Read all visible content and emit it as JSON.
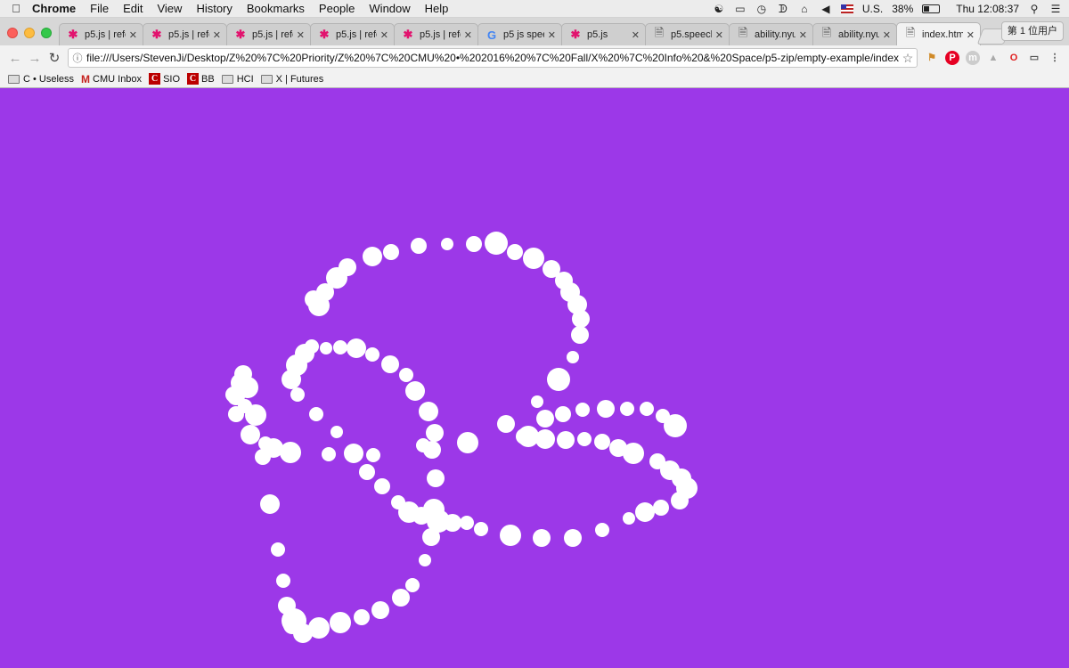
{
  "menubar": {
    "app": "Chrome",
    "items": [
      "File",
      "Edit",
      "View",
      "History",
      "Bookmarks",
      "People",
      "Window",
      "Help"
    ],
    "input_source": "U.S.",
    "battery": "38%",
    "battery_level": 0.38,
    "clock": "Thu 12:08:37"
  },
  "tabs": [
    {
      "title": "p5.js | refe",
      "icon": "p5-star-icon"
    },
    {
      "title": "p5.js | refe",
      "icon": "p5-star-icon"
    },
    {
      "title": "p5.js | refe",
      "icon": "p5-star-icon"
    },
    {
      "title": "p5.js | refe",
      "icon": "p5-star-icon"
    },
    {
      "title": "p5.js | refe",
      "icon": "p5-star-icon"
    },
    {
      "title": "p5 js spee",
      "icon": "google-icon"
    },
    {
      "title": "p5.js",
      "icon": "p5-star-icon"
    },
    {
      "title": "p5.speech",
      "icon": "document-icon"
    },
    {
      "title": "ability.nyu",
      "icon": "document-icon"
    },
    {
      "title": "ability.nyu",
      "icon": "document-icon"
    },
    {
      "title": "index.html",
      "icon": "document-icon",
      "active": true
    }
  ],
  "profile_label": "第 1 位用户",
  "address": {
    "url": "file:///Users/StevenJi/Desktop/Z%20%7C%20Priority/Z%20%7C%20CMU%20•%202016%20%7C%20Fall/X%20%7C%20Info%20&%20Space/p5-zip/empty-example/index.html"
  },
  "bookmarks": [
    {
      "label": "C • Useless",
      "icon": "folder-icon"
    },
    {
      "label": "CMU Inbox",
      "icon": "gmail-icon"
    },
    {
      "label": "SIO",
      "icon": "cmu-icon"
    },
    {
      "label": "BB",
      "icon": "cmu-icon"
    },
    {
      "label": "HCI",
      "icon": "folder-icon"
    },
    {
      "label": "X | Futures",
      "icon": "folder-icon"
    }
  ],
  "canvas": {
    "background": "#9c38e8",
    "dot_color": "#ffffff"
  }
}
